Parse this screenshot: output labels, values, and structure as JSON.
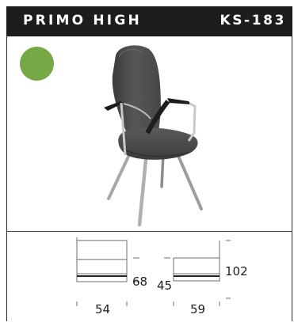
{
  "product": {
    "name": "PRIMO HIGH",
    "code": "KS-183",
    "swatch_color": "#76a846"
  },
  "dimensions": {
    "seat_height": "68",
    "seat_depth": "45",
    "total_height": "102",
    "width": "54",
    "depth": "59"
  }
}
